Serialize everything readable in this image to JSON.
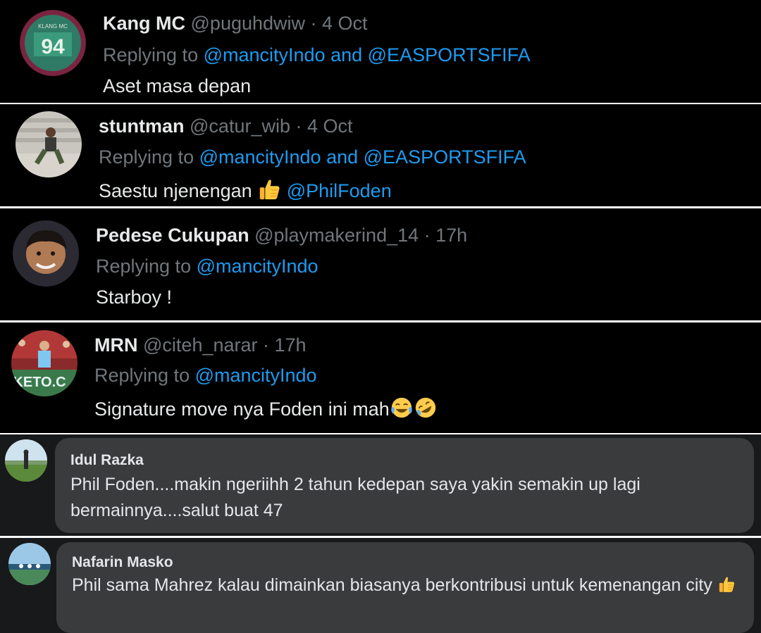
{
  "tweets": [
    {
      "name": "Kang MC",
      "handle": "@puguhdwiw",
      "time": "4 Oct",
      "replying_prefix": "Replying to ",
      "mentions": [
        "@mancityIndo",
        "@EASPORTSFIFA"
      ],
      "joiner": " and ",
      "text": "Aset masa depan"
    },
    {
      "name": "stuntman",
      "handle": "@catur_wib",
      "time": "4 Oct",
      "replying_prefix": "Replying to ",
      "mentions": [
        "@mancityIndo",
        "@EASPORTSFIFA"
      ],
      "joiner": " and ",
      "text": "Saestu njenengan",
      "text_mention": "@PhilFoden",
      "emoji": "thumbs-up"
    },
    {
      "name": "Pedese Cukupan",
      "handle": "@playmakerind_14",
      "time": "17h",
      "replying_prefix": "Replying to ",
      "mentions": [
        "@mancityIndo"
      ],
      "text": "Starboy !"
    },
    {
      "name": "MRN",
      "handle": "@citeh_narar",
      "time": "17h",
      "replying_prefix": "Replying to ",
      "mentions": [
        "@mancityIndo"
      ],
      "text": "Signature move nya Foden ini mah",
      "emoji": [
        "tears-of-joy",
        "rolling-laughing"
      ]
    }
  ],
  "dot": " · ",
  "fb_comments": [
    {
      "name": "Idul Razka",
      "text": "Phil Foden....makin ngeriihh 2 tahun kedepan saya yakin semakin up lagi bermainnya....salut buat 47"
    },
    {
      "name": "Nafarin Masko",
      "text": "Phil sama Mahrez kalau dimainkan biasanya berkontribusi untuk kemenangan city",
      "emoji": "thumbs-up"
    }
  ],
  "colors": {
    "tw_bg": "#000000",
    "tw_name": "#e7e9ea",
    "tw_meta": "#71767b",
    "tw_link": "#1d9bf0",
    "fb_bg": "#18191a",
    "fb_bubble": "#3a3b3c",
    "fb_text": "#e4e6eb"
  }
}
